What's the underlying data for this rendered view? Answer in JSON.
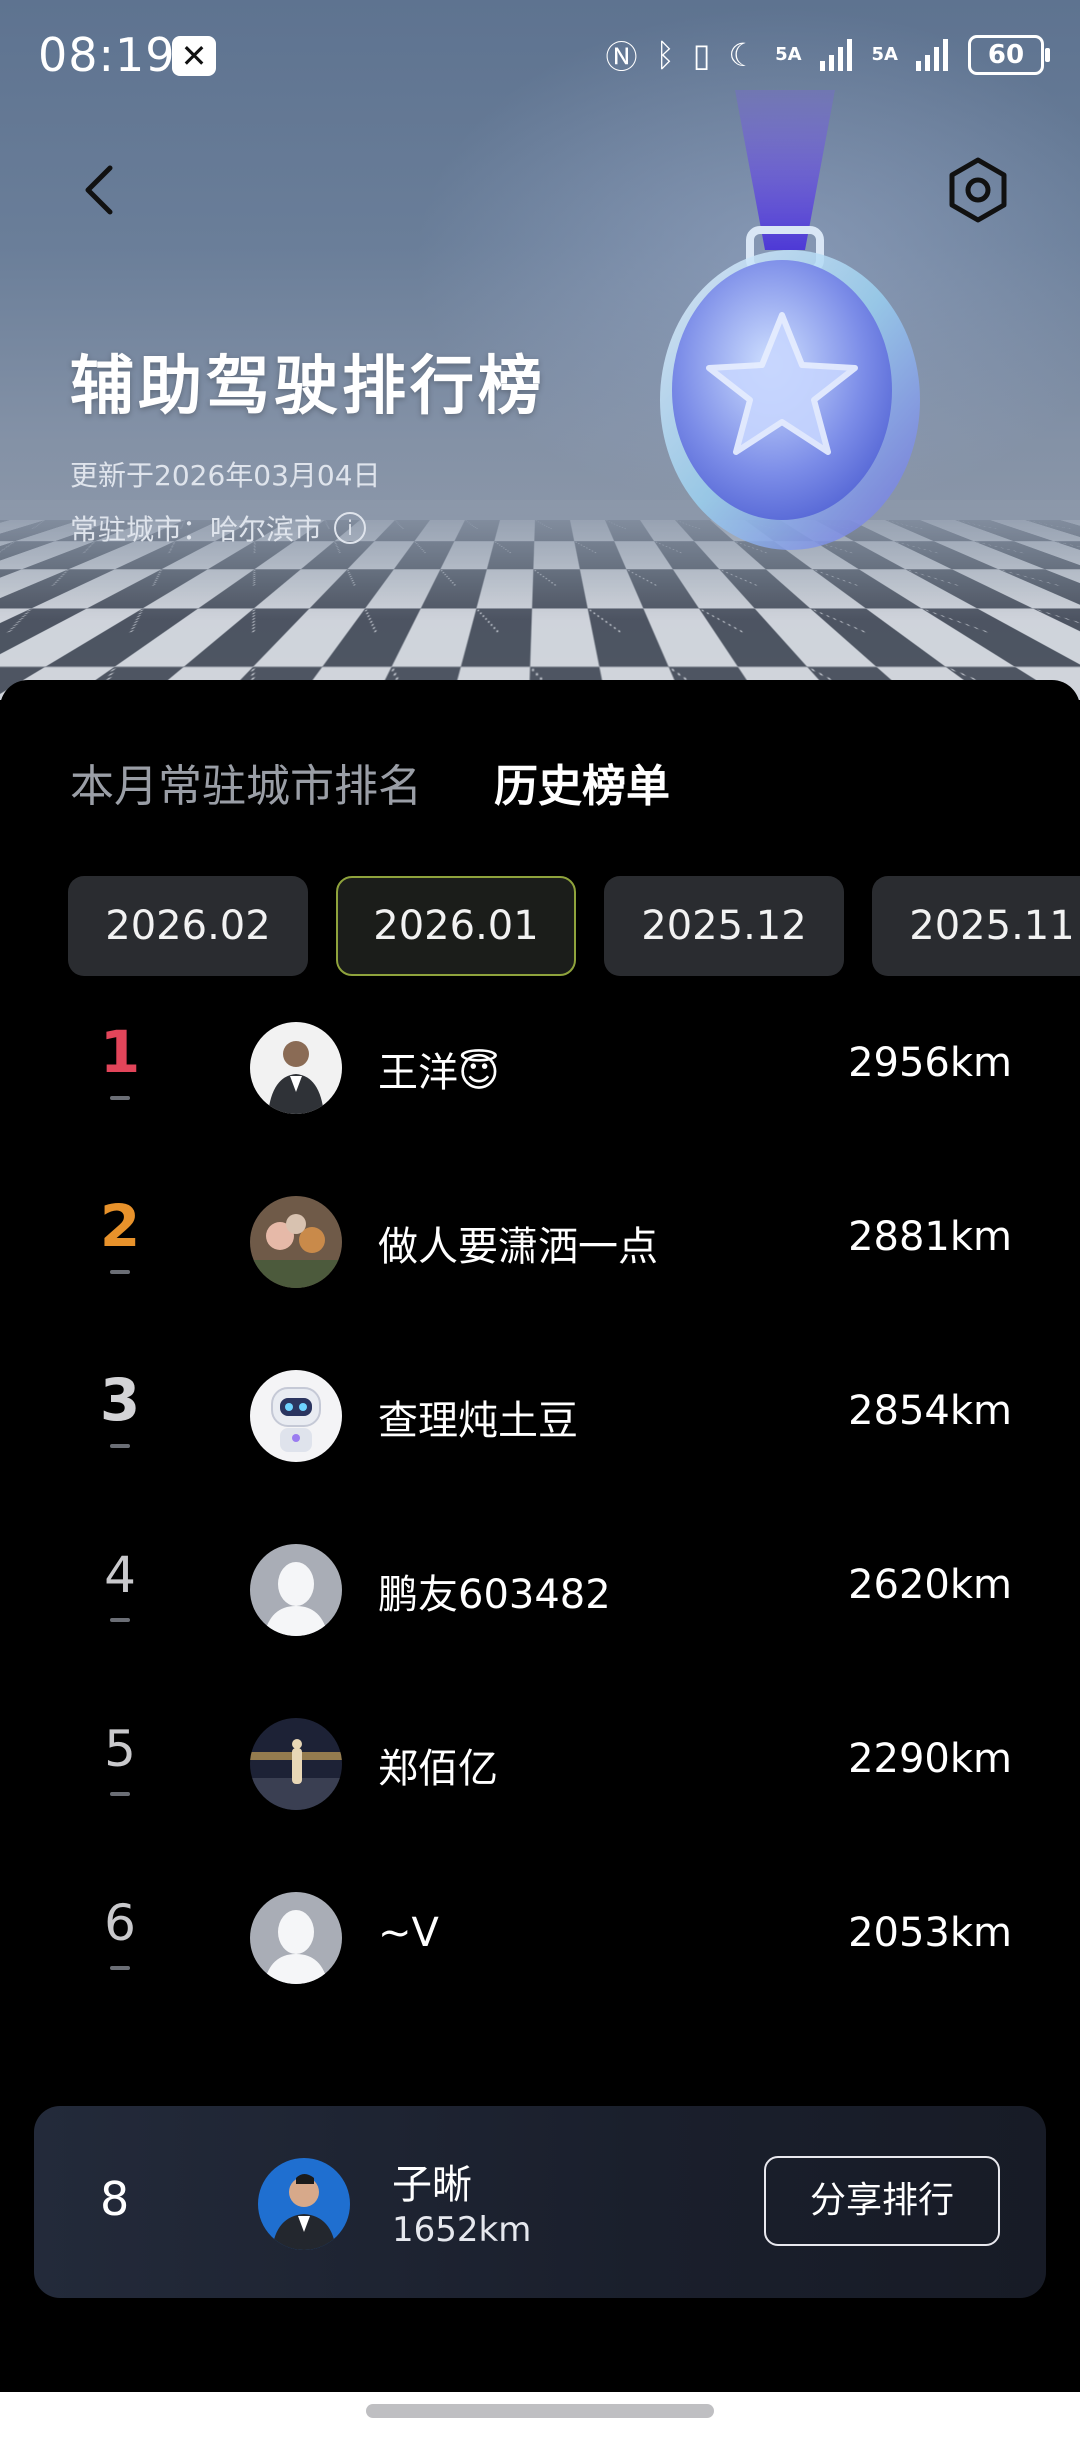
{
  "status_bar": {
    "time": "08:19",
    "app_badge": "✕",
    "network1": "5A",
    "network2": "5A",
    "battery": "60"
  },
  "header": {
    "title": "辅助驾驶排行榜",
    "updated": "更新于2026年03月04日",
    "city": "常驻城市：哈尔滨市",
    "info_icon": "i"
  },
  "tabs": [
    {
      "label": "本月常驻城市排名",
      "active": false
    },
    {
      "label": "历史榜单",
      "active": true
    }
  ],
  "months": [
    {
      "label": "2026.02",
      "selected": false
    },
    {
      "label": "2026.01",
      "selected": true
    },
    {
      "label": "2025.12",
      "selected": false
    },
    {
      "label": "2025.11",
      "selected": false
    }
  ],
  "ranking": [
    {
      "rank": "1",
      "name": "王洋😇",
      "distance": "2956km",
      "avatar": "photo-man-suit"
    },
    {
      "rank": "2",
      "name": "做人要潇洒一点",
      "distance": "2881km",
      "avatar": "photo-family"
    },
    {
      "rank": "3",
      "name": "查理炖土豆",
      "distance": "2854km",
      "avatar": "robot"
    },
    {
      "rank": "4",
      "name": "鹏友603482",
      "distance": "2620km",
      "avatar": "default-avatar"
    },
    {
      "rank": "5",
      "name": "郑佰亿",
      "distance": "2290km",
      "avatar": "photo-night"
    },
    {
      "rank": "6",
      "name": "~V",
      "distance": "2053km",
      "avatar": "default-avatar"
    }
  ],
  "my_rank": {
    "rank": "8",
    "name": "子晰",
    "distance": "1652km",
    "share_label": "分享排行"
  },
  "colors": {
    "rank1": "#e2455a",
    "rank2": "#e8922b",
    "selected_chip_border": "#8fa33c"
  }
}
